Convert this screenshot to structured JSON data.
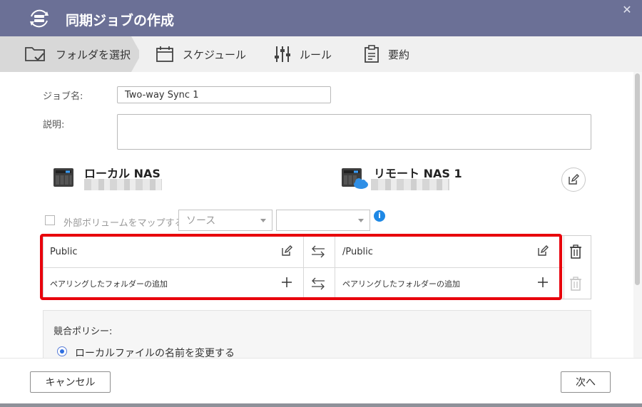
{
  "window": {
    "title": "同期ジョブの作成",
    "close_glyph": "✕"
  },
  "steps": [
    {
      "label": "フォルダを選択",
      "icon": "folder-check-icon",
      "active": true
    },
    {
      "label": "スケジュール",
      "icon": "calendar-icon",
      "active": false
    },
    {
      "label": "ルール",
      "icon": "sliders-icon",
      "active": false
    },
    {
      "label": "要約",
      "icon": "clipboard-icon",
      "active": false
    }
  ],
  "form": {
    "job_name_label": "ジョブ名:",
    "job_name_value": "Two-way Sync 1",
    "description_label": "説明:",
    "description_value": ""
  },
  "local_nas": {
    "name": "ローカル NAS",
    "icon": "nas-device-icon"
  },
  "remote_nas": {
    "name": "リモート NAS 1",
    "icon": "nas-cloud-icon"
  },
  "map_volume": {
    "label": "外部ボリュームをマップする",
    "checked": false,
    "source_select": "ソース",
    "target_select": "",
    "info_glyph": "i"
  },
  "pairs": {
    "rows": [
      {
        "local": "Public",
        "remote": "/Public",
        "local_action": "edit-icon",
        "remote_action": "edit-icon"
      },
      {
        "local": "ペアリングしたフォルダーの追加",
        "remote": "ペアリングしたフォルダーの追加",
        "local_action": "plus-icon",
        "remote_action": "plus-icon"
      }
    ]
  },
  "policy": {
    "label": "競合ポリシー:",
    "selected_option": "ローカルファイルの名前を変更する"
  },
  "footer": {
    "cancel_label": "キャンセル",
    "next_label": "次へ"
  },
  "colors": {
    "titlebar": "#6b7096",
    "highlight_frame": "#e8000b",
    "info": "#1e88e5",
    "radio": "#2f6fe0"
  }
}
